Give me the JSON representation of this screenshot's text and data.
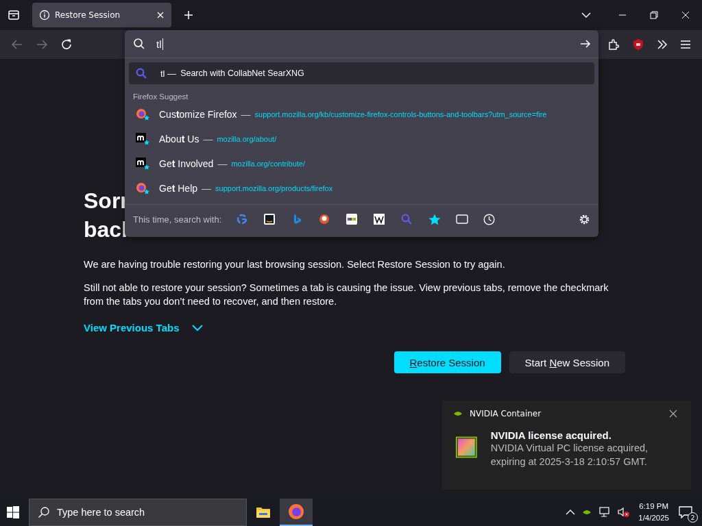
{
  "tab_bar": {
    "tabs": [
      {
        "title": "Restore Session",
        "selected": true
      }
    ]
  },
  "address_bar": {
    "value": "tl"
  },
  "urlbar_popup": {
    "heuristic": {
      "query": "tl",
      "separator": "—",
      "action": "Search with CollabNet SearXNG",
      "selected": true
    },
    "group_label": "Firefox Suggest",
    "suggestions": [
      {
        "kind": "firefox",
        "title": "Cus**t**omize Firefox",
        "separator": "—",
        "url": "support.mozilla.org/kb/customize-firefox-controls-buttons-and-toolbars?utm_source=fire",
        "selected": false
      },
      {
        "kind": "mozilla",
        "title": "Abou**t** Us",
        "separator": "—",
        "url": "mozilla.org/about/",
        "selected": false
      },
      {
        "kind": "mozilla",
        "title": "Ge**t** Involved",
        "separator": "—",
        "url": "mozilla.org/contribute/",
        "selected": false
      },
      {
        "kind": "firefox",
        "title": "Ge**t** Help",
        "separator": "—",
        "url": "support.mozilla.org/products/firefox",
        "selected": false
      }
    ],
    "search_with_label": "This time, search with:"
  },
  "page": {
    "heading": [
      "Sorr",
      "bacl"
    ],
    "paragraphs": [
      "We are having trouble restoring your last browsing session. Select Restore Session to try again.",
      "Still not able to restore your session? Sometimes a tab is causing the issue. View previous tabs, remove the checkmark from the tabs you don’t need to recover, and then restore."
    ],
    "view_previous_tabs": {
      "label": "View Previous Tabs",
      "expanded": false
    },
    "buttons": [
      {
        "key": "R",
        "after": "estore Session",
        "primary": true
      },
      {
        "before": "Start ",
        "key": "N",
        "after": "ew Session",
        "primary": false
      }
    ]
  },
  "notification": {
    "app": "NVIDIA Container",
    "title": "NVIDIA license acquired.",
    "body": "NVIDIA Virtual PC license acquired, expiring at 2025-3-18 2:10:57 GMT."
  },
  "taskbar": {
    "search_placeholder": "Type here to search",
    "apps": [
      {
        "kind": "folder",
        "selected": false
      },
      {
        "kind": "firefox",
        "selected": true
      }
    ],
    "time": "6:19 PM",
    "date": "1/4/2025",
    "notification_count": "2"
  }
}
